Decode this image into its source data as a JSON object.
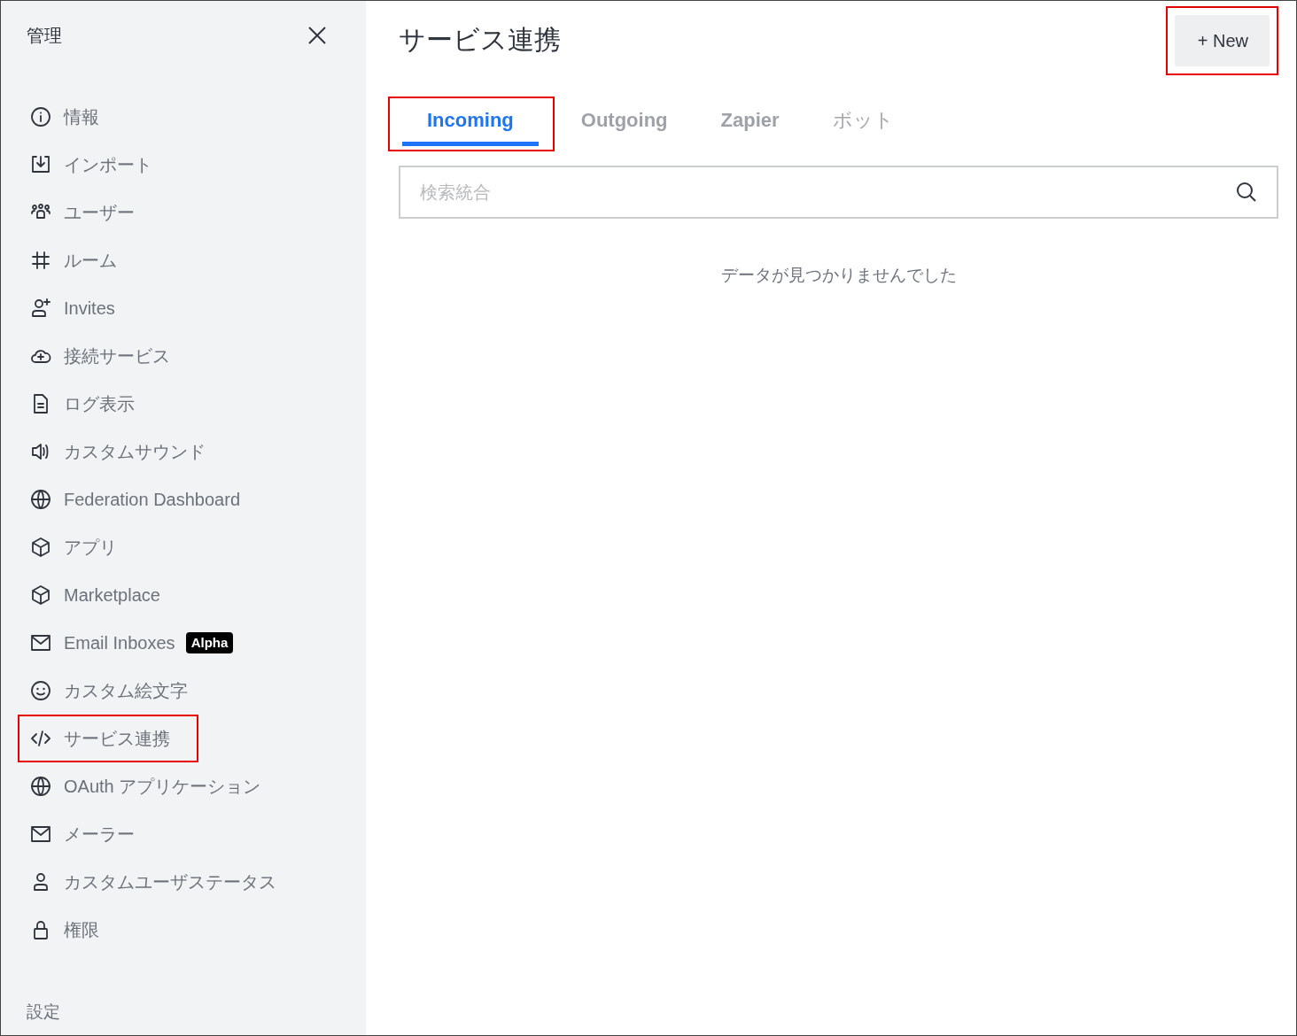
{
  "sidebar": {
    "title": "管理",
    "items": [
      {
        "label": "情報",
        "highlighted": false
      },
      {
        "label": "インポート",
        "highlighted": false
      },
      {
        "label": "ユーザー",
        "highlighted": false
      },
      {
        "label": "ルーム",
        "highlighted": false
      },
      {
        "label": "Invites",
        "highlighted": false
      },
      {
        "label": "接続サービス",
        "highlighted": false
      },
      {
        "label": "ログ表示",
        "highlighted": false
      },
      {
        "label": "カスタムサウンド",
        "highlighted": false
      },
      {
        "label": "Federation Dashboard",
        "highlighted": false
      },
      {
        "label": "アプリ",
        "highlighted": false
      },
      {
        "label": "Marketplace",
        "highlighted": false
      },
      {
        "label": "Email Inboxes",
        "badge": "Alpha",
        "highlighted": false
      },
      {
        "label": "カスタム絵文字",
        "highlighted": false
      },
      {
        "label": "サービス連携",
        "highlighted": true
      },
      {
        "label": "OAuth アプリケーション",
        "highlighted": false
      },
      {
        "label": "メーラー",
        "highlighted": false
      },
      {
        "label": "カスタムユーザステータス",
        "highlighted": false
      },
      {
        "label": "権限",
        "highlighted": false
      }
    ],
    "footer": "設定"
  },
  "main": {
    "title": "サービス連携",
    "new_button": {
      "icon_text": "+",
      "label": "New",
      "highlighted": true
    },
    "tabs": [
      {
        "label": "Incoming",
        "selected": true,
        "highlighted": true
      },
      {
        "label": "Outgoing",
        "selected": false,
        "highlighted": false
      },
      {
        "label": "Zapier",
        "selected": false,
        "highlighted": false
      },
      {
        "label": "ボット",
        "selected": false,
        "highlighted": false,
        "kind": "dim"
      }
    ],
    "search": {
      "placeholder": "検索統合"
    },
    "empty_message": "データが見つかりませんでした"
  }
}
